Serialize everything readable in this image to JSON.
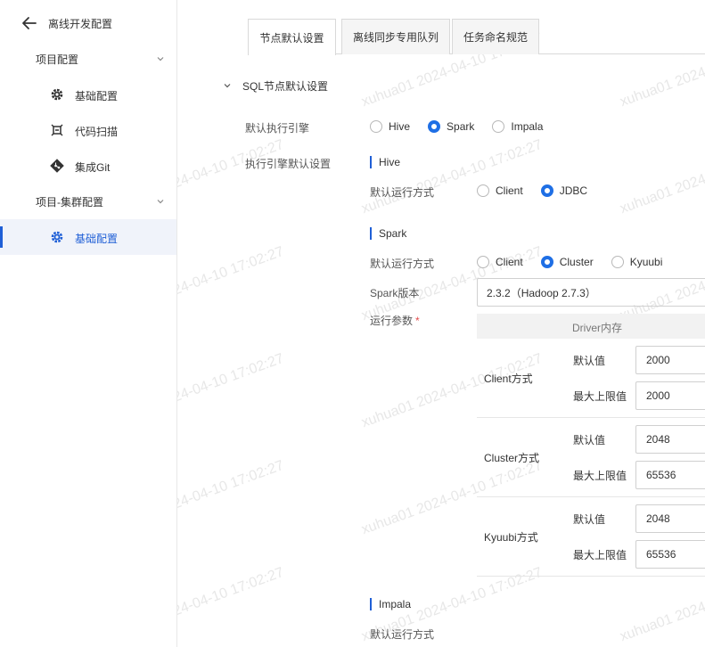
{
  "sidebar": {
    "title": "离线开发配置",
    "groups": [
      {
        "label": "项目配置",
        "items": [
          {
            "label": "基础配置",
            "icon": "gear-icon"
          },
          {
            "label": "代码扫描",
            "icon": "bug-scan-icon"
          },
          {
            "label": "集成Git",
            "icon": "git-icon"
          }
        ]
      },
      {
        "label": "项目-集群配置",
        "items": [
          {
            "label": "基础配置",
            "icon": "gear-icon",
            "active": true
          }
        ]
      }
    ]
  },
  "tabs": [
    {
      "label": "节点默认设置",
      "active": true
    },
    {
      "label": "离线同步专用队列"
    },
    {
      "label": "任务命名规范"
    }
  ],
  "section": {
    "title": "SQL节点默认设置"
  },
  "form": {
    "engine_label": "默认执行引擎",
    "engine_options": [
      "Hive",
      "Spark",
      "Impala"
    ],
    "engine_selected": "Spark",
    "engine_defaults_label": "执行引擎默认设置",
    "hive": {
      "title": "Hive",
      "run_mode_label": "默认运行方式",
      "options": [
        "Client",
        "JDBC"
      ],
      "selected": "JDBC"
    },
    "spark": {
      "title": "Spark",
      "run_mode_label": "默认运行方式",
      "options": [
        "Client",
        "Cluster",
        "Kyuubi"
      ],
      "selected": "Cluster",
      "version_label": "Spark版本",
      "version_value": "2.3.2（Hadoop 2.7.3）",
      "params_label": "运行参数",
      "params_required_mark": "*",
      "params_header": "Driver内存",
      "groups": [
        {
          "name": "Client方式",
          "default_label": "默认值",
          "default_value": "2000",
          "max_label": "最大上限值",
          "max_value": "2000"
        },
        {
          "name": "Cluster方式",
          "default_label": "默认值",
          "default_value": "2048",
          "max_label": "最大上限值",
          "max_value": "65536"
        },
        {
          "name": "Kyuubi方式",
          "default_label": "默认值",
          "default_value": "2048",
          "max_label": "最大上限值",
          "max_value": "65536"
        }
      ]
    },
    "impala": {
      "title": "Impala",
      "run_mode_label": "默认运行方式"
    }
  },
  "watermark": "xuhua01 2024-04-10 17:02:27",
  "colors": {
    "accent": "#1f6fe5",
    "active_bg": "#f0f3fa"
  }
}
